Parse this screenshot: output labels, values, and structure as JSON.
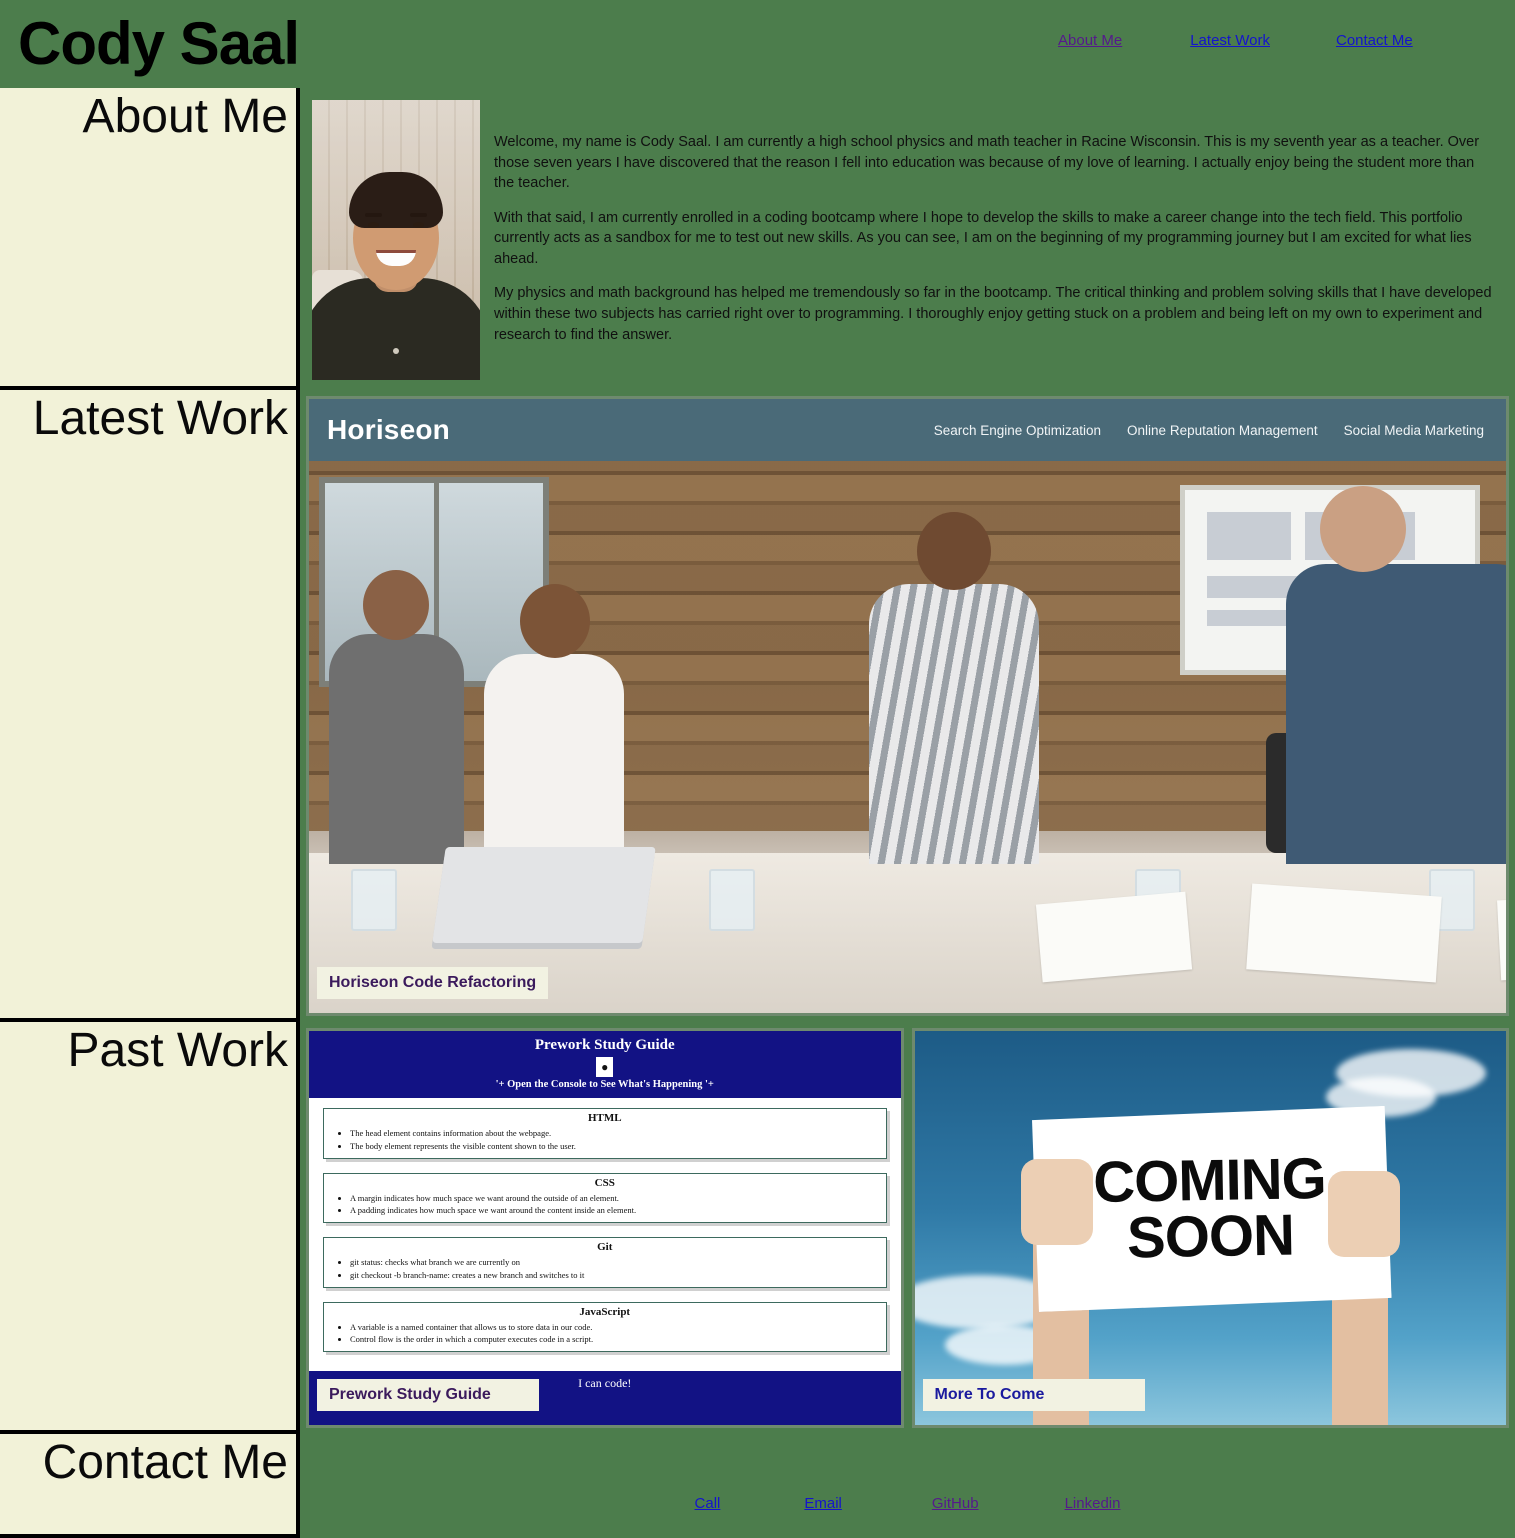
{
  "header": {
    "title": "Cody Saal",
    "nav": [
      {
        "label": "About Me",
        "state": "visited"
      },
      {
        "label": "Latest Work",
        "state": "link"
      },
      {
        "label": "Contact Me",
        "state": "link"
      }
    ]
  },
  "sections": {
    "about": {
      "label": "About Me",
      "avatar_alt": "Portrait photo of Cody Saal",
      "paragraphs": [
        "Welcome, my name is Cody Saal. I am currently a high school physics and math teacher in Racine Wisconsin. This is my seventh year as a teacher. Over those seven years I have discovered that the reason I fell into education was because of my love of learning. I actually enjoy being the student more than the teacher.",
        "With that said, I am currently enrolled in a coding bootcamp where I hope to develop the skills to make a career change into the tech field. This portfolio currently acts as a sandbox for me to test out new skills. As you can see, I am on the beginning of my programming journey but I am excited for what lies ahead.",
        "My physics and math background has helped me tremendously so far in the bootcamp. The critical thinking and problem solving skills that I have developed within these two subjects has carried right over to programming. I thoroughly enjoy getting stuck on a problem and being left on my own to experiment and research to find the answer."
      ]
    },
    "latest": {
      "label": "Latest Work",
      "card": {
        "caption": "Horiseon Code Refactoring",
        "preview": {
          "logo": "Horiseon",
          "nav": [
            "Search Engine Optimization",
            "Online Reputation Management",
            "Social Media Marketing"
          ]
        }
      }
    },
    "past": {
      "label": "Past Work",
      "cards": [
        {
          "caption": "Prework Study Guide",
          "caption_style": "purple",
          "preview": {
            "title": "Prework Study Guide",
            "icon": "console-icon",
            "subtitle": "'+ Open the Console to See What's Happening '+",
            "boxes": [
              {
                "title": "HTML",
                "items": [
                  "The head element contains information about the webpage.",
                  "The body element represents the visible content shown to the user."
                ]
              },
              {
                "title": "CSS",
                "items": [
                  "A margin indicates how much space we want around the outside of an element.",
                  "A padding indicates how much space we want around the content inside an element."
                ]
              },
              {
                "title": "Git",
                "items": [
                  "git status: checks what branch we are currently on",
                  "git checkout -b branch-name: creates a new branch and switches to it"
                ]
              },
              {
                "title": "JavaScript",
                "items": [
                  "A variable is a named container that allows us to store data in our code.",
                  "Control flow is the order in which a computer executes code in a script."
                ]
              }
            ],
            "footer": "I can code!"
          }
        },
        {
          "caption": "More To Come",
          "caption_style": "blue",
          "preview": {
            "sign_line_1": "COMING",
            "sign_line_2": "SOON"
          }
        }
      ]
    },
    "contact": {
      "label": "Contact Me",
      "links": [
        {
          "label": "Call",
          "state": "link"
        },
        {
          "label": "Email",
          "state": "link"
        },
        {
          "label": "GitHub",
          "state": "visited"
        },
        {
          "label": "Linkedin",
          "state": "visited"
        }
      ]
    }
  },
  "colors": {
    "brand_green": "#4c7d4c",
    "label_cream": "#f2f2d8",
    "caption_purple": "#3b1a5c",
    "caption_blue": "#1a1a9e",
    "link_blue": "#1414cc",
    "link_visited": "#551a8b",
    "horiseon_bar": "#4a6a78",
    "psg_navy": "#121284"
  }
}
